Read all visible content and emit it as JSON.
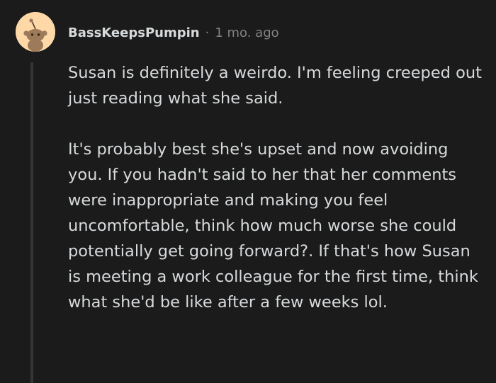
{
  "comment": {
    "author": "BassKeepsPumpin",
    "separator": "·",
    "age": "1 mo. ago",
    "paragraphs": [
      "Susan is definitely a weirdo. I'm feeling creeped out just reading what she said.",
      "It's probably best she's upset and now avoiding you. If you hadn't said to her that her comments were inappropriate and making you feel uncomfortable, think how much worse she could potentially get going forward?. If that's how Susan is meeting a work colleague for the first time, think what she'd be like after a few weeks lol."
    ],
    "avatar_icon": "snoo-avatar-icon"
  },
  "colors": {
    "background": "#1b1b1b",
    "text": "#d7dadc",
    "meta_text": "#818384",
    "thread_line": "#343536",
    "avatar_bg": "#ffd8a8"
  }
}
